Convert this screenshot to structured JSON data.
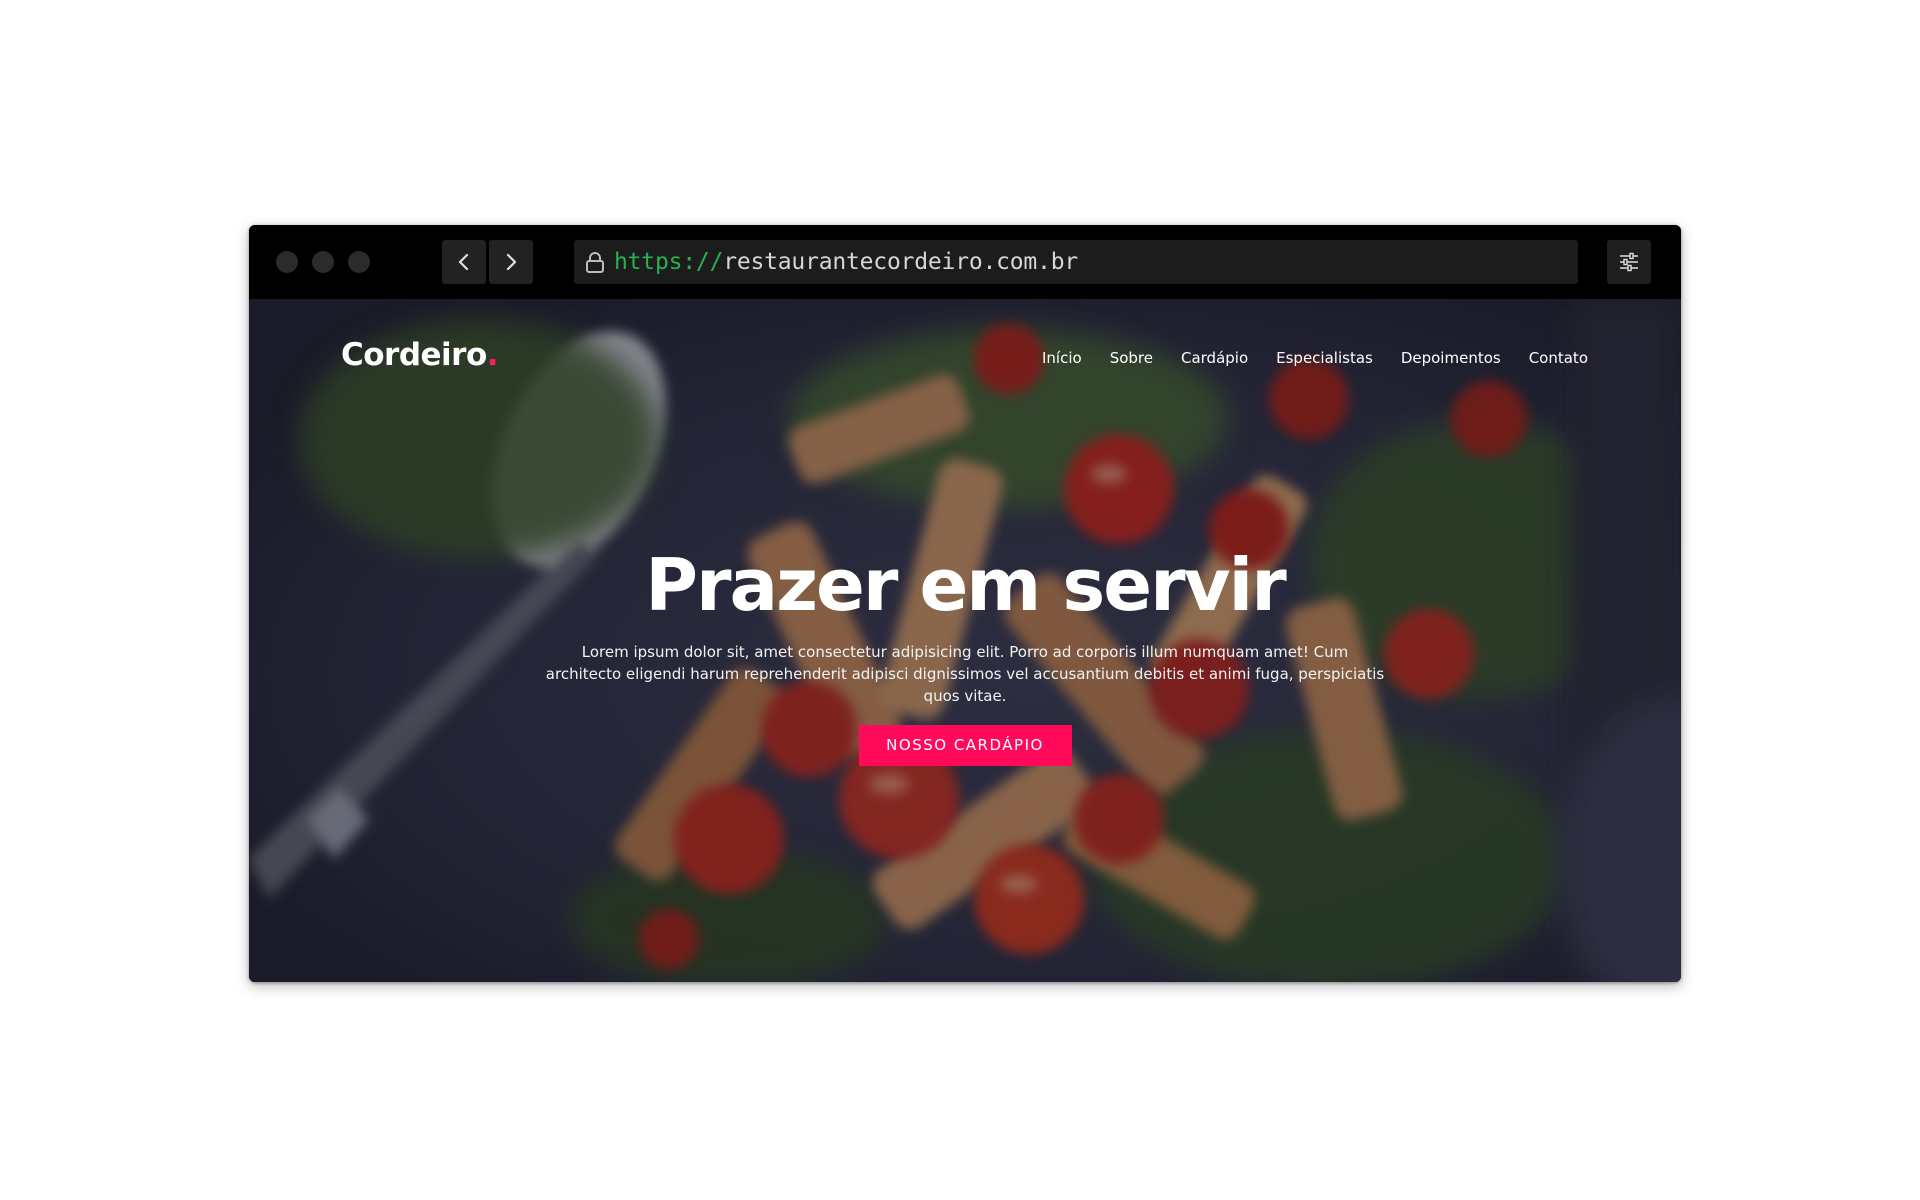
{
  "browser": {
    "url_scheme": "https://",
    "url_host": "restaurantecordeiro.com.br"
  },
  "site": {
    "logo_text": "Cordeiro",
    "logo_dot": ".",
    "nav": [
      {
        "label": "Início"
      },
      {
        "label": "Sobre"
      },
      {
        "label": "Cardápio"
      },
      {
        "label": "Especialistas"
      },
      {
        "label": "Depoimentos"
      },
      {
        "label": "Contato"
      }
    ],
    "hero": {
      "title": "Prazer em servir",
      "text": "Lorem ipsum dolor sit, amet consectetur adipisicing elit. Porro ad corporis illum numquam amet! Cum architecto eligendi harum reprehenderit adipisci dignissimos vel accusantium debitis et animi fuga, perspiciatis quos vitae.",
      "cta_label": "NOSSO CARDÁPIO"
    }
  },
  "colors": {
    "accent": "#ff0a5a",
    "url_scheme": "#28b14c",
    "toolbar": "#000000"
  },
  "icons": {
    "back": "chevron-left-icon",
    "forward": "chevron-right-icon",
    "lock": "lock-icon",
    "settings": "sliders-icon"
  }
}
